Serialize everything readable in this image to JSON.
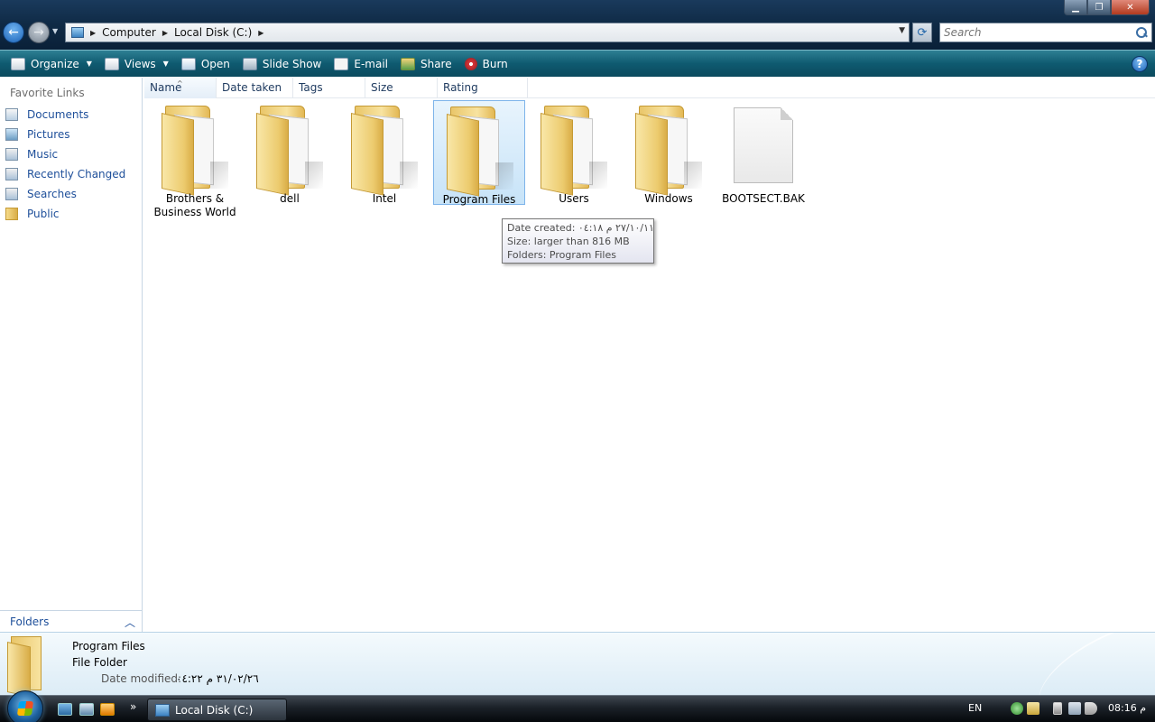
{
  "window": {
    "min_label": "▁",
    "max_label": "❐",
    "close_label": "✕"
  },
  "nav": {
    "back_glyph": "←",
    "forward_glyph": "→",
    "dropdown_glyph": "▼"
  },
  "address": {
    "icon": "computer-icon",
    "crumbs": [
      "Computer",
      "Local Disk (C:)"
    ],
    "separator": "▶",
    "dropdown_glyph": "▼"
  },
  "refresh_glyph": "⟳",
  "search": {
    "placeholder": "Search"
  },
  "toolbar": {
    "organize": "Organize",
    "views": "Views",
    "open": "Open",
    "slideshow": "Slide Show",
    "email": "E-mail",
    "share": "Share",
    "burn": "Burn",
    "caret": "▼",
    "help": "?"
  },
  "sidebar": {
    "title": "Favorite Links",
    "items": [
      {
        "label": "Documents",
        "icon": "documents-icon"
      },
      {
        "label": "Pictures",
        "icon": "pictures-icon"
      },
      {
        "label": "Music",
        "icon": "music-icon"
      },
      {
        "label": "Recently Changed",
        "icon": "recently-changed-icon"
      },
      {
        "label": "Searches",
        "icon": "searches-icon"
      },
      {
        "label": "Public",
        "icon": "public-folder-icon"
      }
    ],
    "folders_label": "Folders",
    "folders_chevron": "︿"
  },
  "columns": [
    "Name",
    "Date taken",
    "Tags",
    "Size",
    "Rating"
  ],
  "sort_glyph": "^",
  "items": [
    {
      "label": "Brothers & Business World",
      "type": "folder"
    },
    {
      "label": "dell",
      "type": "folder"
    },
    {
      "label": "Intel",
      "type": "folder"
    },
    {
      "label": "Program Files",
      "type": "folder",
      "selected": true
    },
    {
      "label": "Users",
      "type": "folder"
    },
    {
      "label": "Windows",
      "type": "folder"
    },
    {
      "label": "BOOTSECT.BAK",
      "type": "file"
    }
  ],
  "tooltip": {
    "date_created": "Date created: ٢٧/١٠/١١ م ٠٤:١٨",
    "size": "Size: larger than 816 MB",
    "folders": "Folders: Program Files"
  },
  "details": {
    "name": "Program Files",
    "type": "File Folder",
    "modified_label": "Date modified:",
    "modified_value": "٣١/٠٢/٢٦ م ٠٤:٢٢"
  },
  "taskbar": {
    "more": "»",
    "task_label": "Local Disk (C:)",
    "lang": "EN",
    "clock": "08:16 م"
  }
}
